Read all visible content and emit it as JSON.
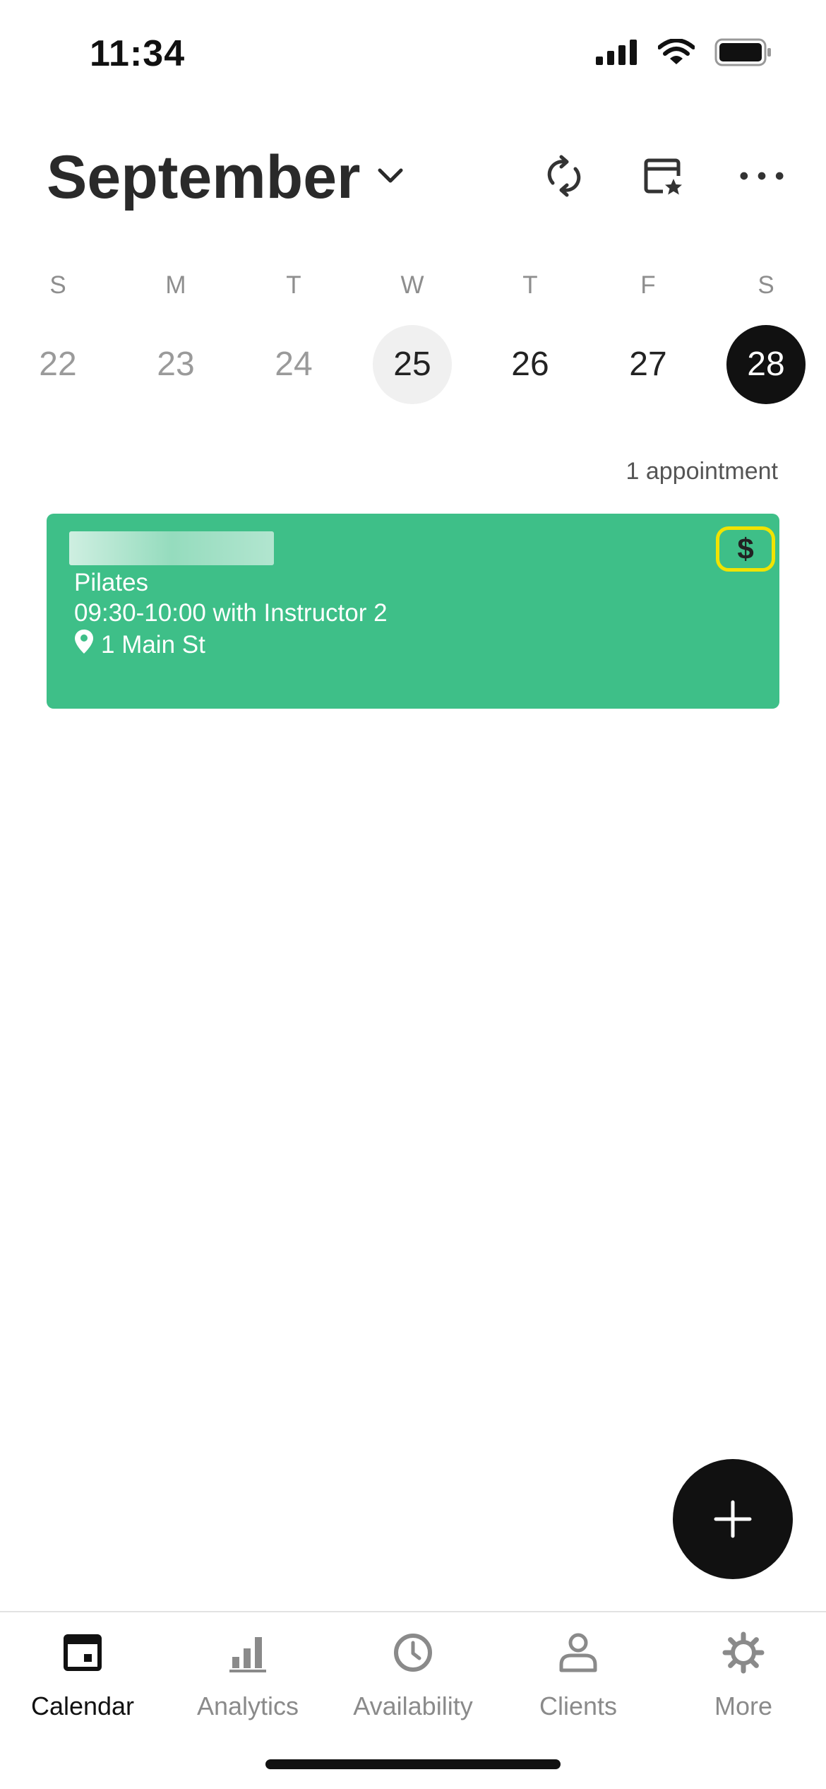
{
  "status_bar": {
    "time": "11:34"
  },
  "header": {
    "month": "September",
    "actions": [
      "sync-icon",
      "calendar-star-icon",
      "more-horizontal-icon"
    ]
  },
  "week": {
    "weekdays": [
      "S",
      "M",
      "T",
      "W",
      "T",
      "F",
      "S"
    ],
    "dates": [
      "22",
      "23",
      "24",
      "25",
      "26",
      "27",
      "28"
    ],
    "today": "25",
    "selected": "28"
  },
  "appointments": {
    "count_label": "1 appointment",
    "items": [
      {
        "service": "Pilates",
        "time": "09:30-10:00 with Instructor 2",
        "location": "1 Main St",
        "badge": "$",
        "color": "#3ebf88"
      }
    ]
  },
  "tabbar": {
    "tabs": [
      {
        "label": "Calendar",
        "icon": "calendar-icon",
        "active": true
      },
      {
        "label": "Analytics",
        "icon": "bar-chart-icon",
        "active": false
      },
      {
        "label": "Availability",
        "icon": "clock-icon",
        "active": false
      },
      {
        "label": "Clients",
        "icon": "person-icon",
        "active": false
      },
      {
        "label": "More",
        "icon": "gear-icon",
        "active": false
      }
    ]
  },
  "colors": {
    "accent": "#3ebf88",
    "highlight": "#f1e300",
    "dark": "#111111"
  }
}
